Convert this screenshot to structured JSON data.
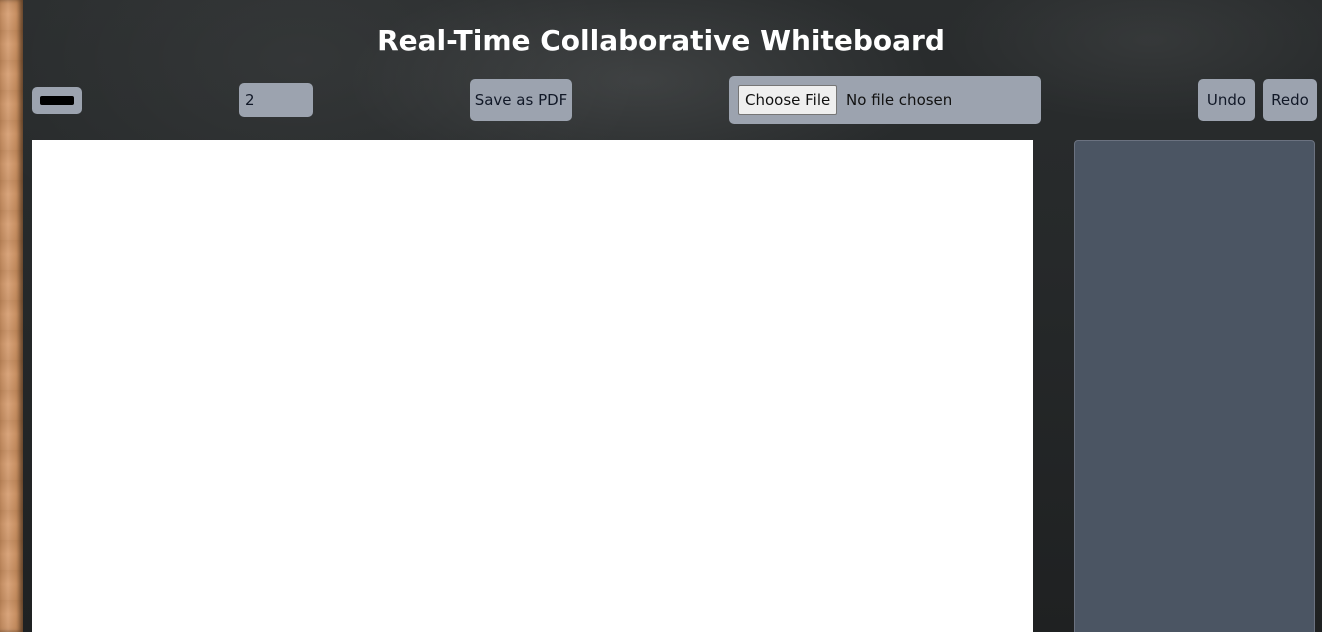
{
  "header": {
    "title": "Real-Time Collaborative Whiteboard"
  },
  "toolbar": {
    "color_value": "#000000",
    "brush_size_value": "2",
    "save_pdf_label": "Save as PDF",
    "file_button_label": "Choose File",
    "file_status": "No file chosen",
    "undo_label": "Undo",
    "redo_label": "Redo"
  },
  "colors": {
    "control_bg": "#9ca3af",
    "canvas_bg": "#ffffff",
    "panel_bg": "#4b5563",
    "board_bg": "#26292a",
    "title_text": "#ffffff"
  }
}
